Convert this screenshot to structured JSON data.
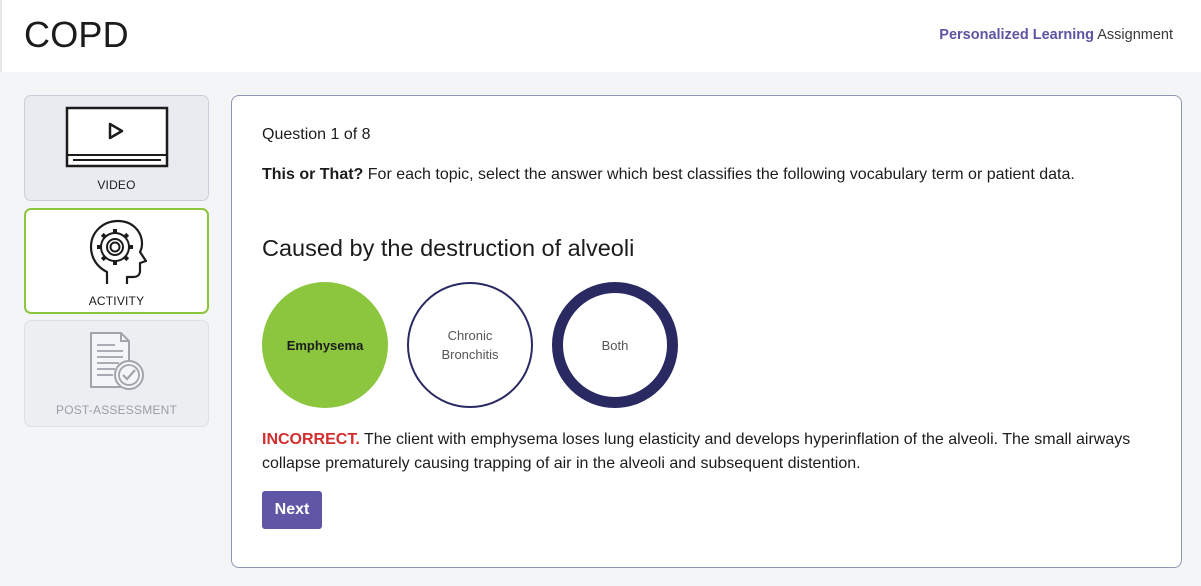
{
  "header": {
    "title": "COPD",
    "tag_strong": "Personalized Learning",
    "tag_rest": "Assignment"
  },
  "sidebar": {
    "items": [
      {
        "label": "VIDEO",
        "icon": "video-player-icon",
        "state": "default"
      },
      {
        "label": "ACTIVITY",
        "icon": "head-gear-icon",
        "state": "active"
      },
      {
        "label": "POST-ASSESSMENT",
        "icon": "document-check-icon",
        "state": "disabled"
      }
    ]
  },
  "question": {
    "counter": "Question 1 of 8",
    "instructions_bold": "This or That?",
    "instructions_rest": "For each topic, select the answer which best classifies the following vocabulary term or patient data.",
    "prompt": "Caused by the destruction of alveoli",
    "choices": [
      {
        "label": "Emphysema",
        "state": "selected"
      },
      {
        "label": "Chronic Bronchitis",
        "state": "default"
      },
      {
        "label": "Both",
        "state": "highlighted"
      }
    ],
    "feedback": {
      "verdict": "INCORRECT.",
      "text": "The client with emphysema loses lung elasticity and develops hyperinflation of the alveoli. The small airways collapse prematurely causing trapping of air in the alveoli and subsequent distention."
    },
    "next_label": "Next"
  },
  "colors": {
    "accent_purple": "#5f57a6",
    "selected_green": "#8cc63f",
    "ring_navy": "#2a2a63",
    "incorrect_red": "#d32d2d"
  }
}
